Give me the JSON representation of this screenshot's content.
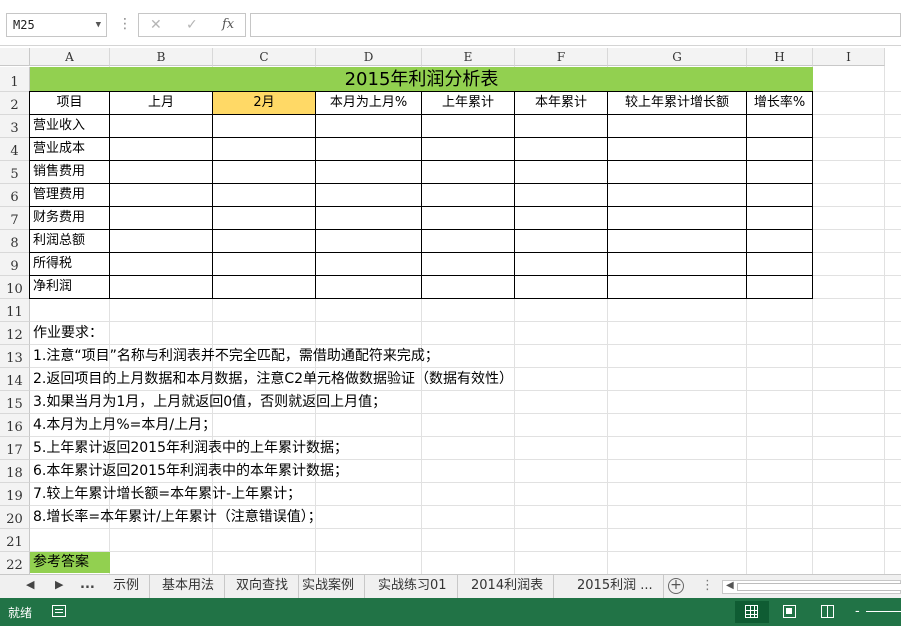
{
  "formula_bar": {
    "name_box": "M25",
    "more": "⋮",
    "cancel_glyph": "✕",
    "enter_glyph": "✓",
    "fx_label": "fx",
    "formula": ""
  },
  "columns": [
    "A",
    "B",
    "C",
    "D",
    "E",
    "F",
    "G",
    "H",
    "I"
  ],
  "rows": [
    "1",
    "2",
    "3",
    "4",
    "5",
    "6",
    "7",
    "8",
    "9",
    "10",
    "11",
    "12",
    "13",
    "14",
    "15",
    "16",
    "17",
    "18",
    "19",
    "20",
    "21",
    "22"
  ],
  "table": {
    "title": "2015年利润分析表",
    "headers": [
      "项目",
      "上月",
      "2月",
      "本月为上月%",
      "上年累计",
      "本年累计",
      "较上年累计增长额",
      "增长率%"
    ],
    "items": [
      "营业收入",
      "营业成本",
      "销售费用",
      "管理费用",
      "财务费用",
      "利润总额",
      "所得税",
      "净利润"
    ]
  },
  "notes": [
    "作业要求：",
    "1.注意“项目”名称与利润表并不完全匹配，需借助通配符来完成；",
    "2.返回项目的上月数据和本月数据，注意C2单元格做数据验证（数据有效性）",
    "3.如果当月为1月，上月就返回0值，否则就返回上月值；",
    "4.本月为上月%=本月/上月；",
    "5.上年累计返回2015年利润表中的上年累计数据；",
    "6.本年累计返回2015年利润表中的本年累计数据；",
    "7.较上年累计增长额=本年累计-上年累计；",
    "8.增长率=本年累计/上年累计（注意错误值）；"
  ],
  "answer_label": "参考答案",
  "sheet_tabs": {
    "prev": "◀",
    "next": "▶",
    "ellipsis": "...",
    "tabs": [
      "示例",
      "基本用法",
      "双向查找",
      "实战案例",
      "实战练习01",
      "2014利润表",
      "2015利润 ..."
    ],
    "add": "+",
    "more": "⋮",
    "scroll_left": "◀"
  },
  "status_bar": {
    "ready": "就绪",
    "zoom_out": "-"
  },
  "colors": {
    "title_fill": "#92d050",
    "selected_header_fill": "#ffd966",
    "status_bar": "#217346"
  }
}
